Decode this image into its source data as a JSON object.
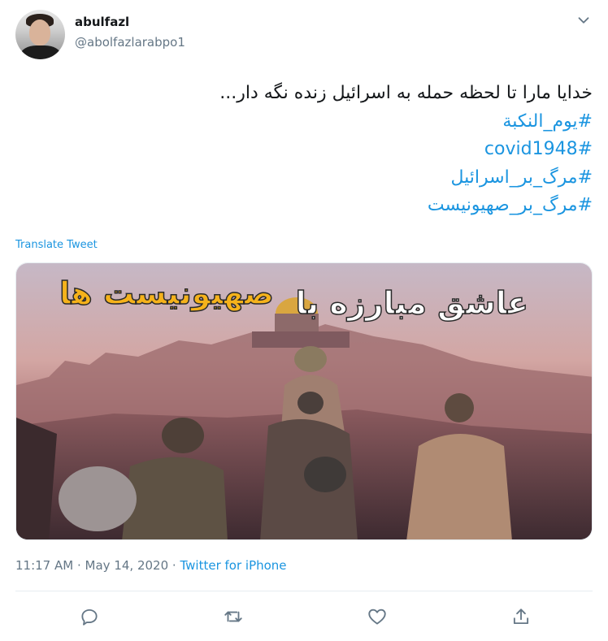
{
  "user": {
    "name": "abulfazl",
    "handle": "@abolfazlarabpo1"
  },
  "tweet": {
    "text_line": "خدایا مارا تا لحظه حمله به اسرائیل زنده نگه دار...",
    "hashtags": [
      "#یوم_النکبة",
      "#covid1948",
      "#مرگ_بر_اسرائیل",
      "#مرگ_بر_صهیونیست"
    ],
    "translate_label": "Translate Tweet"
  },
  "media": {
    "title_right": "عاشق مبارزه با",
    "title_left": "صهیونیست ها",
    "title_right_color": "#ffffff",
    "title_left_color": "#f5b21b"
  },
  "meta": {
    "time": "11:17 AM",
    "separator": "·",
    "date": "May 14, 2020",
    "source": "Twitter for iPhone"
  },
  "actions": [
    "reply-icon",
    "retweet-icon",
    "like-icon",
    "share-icon"
  ],
  "colors": {
    "link": "#1b95e0",
    "muted": "#657786",
    "text": "#14171a"
  }
}
